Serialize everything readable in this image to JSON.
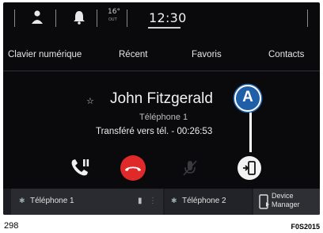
{
  "status_bar": {
    "icons": [
      "user-icon",
      "bell-icon"
    ],
    "temperature": "16°",
    "temperature_sub": "OUT",
    "time": "12:30"
  },
  "tabs": [
    {
      "label": "Clavier numérique"
    },
    {
      "label": "Récent"
    },
    {
      "label": "Favoris"
    },
    {
      "label": "Contacts"
    }
  ],
  "call": {
    "contact_name": "John Fitzgerald",
    "phone_label": "Téléphone 1",
    "status": "Transféré vers tél. - 00:26:53",
    "buttons": [
      "call-transfer-icon",
      "hang-up-icon",
      "mute-icon",
      "transfer-to-phone-icon"
    ]
  },
  "bottom_bar": {
    "phone1_label": "Téléphone 1",
    "phone2_label": "Téléphone 2",
    "device_manager_label": "Device\nManager"
  },
  "annotation": {
    "letter": "A"
  },
  "page": {
    "number": "298",
    "figure_code": "F0S2015"
  },
  "colors": {
    "hangup_red": "#e02a2a",
    "callout_blue": "#1e5fa8",
    "screen_bg": "#0a0a0c"
  }
}
